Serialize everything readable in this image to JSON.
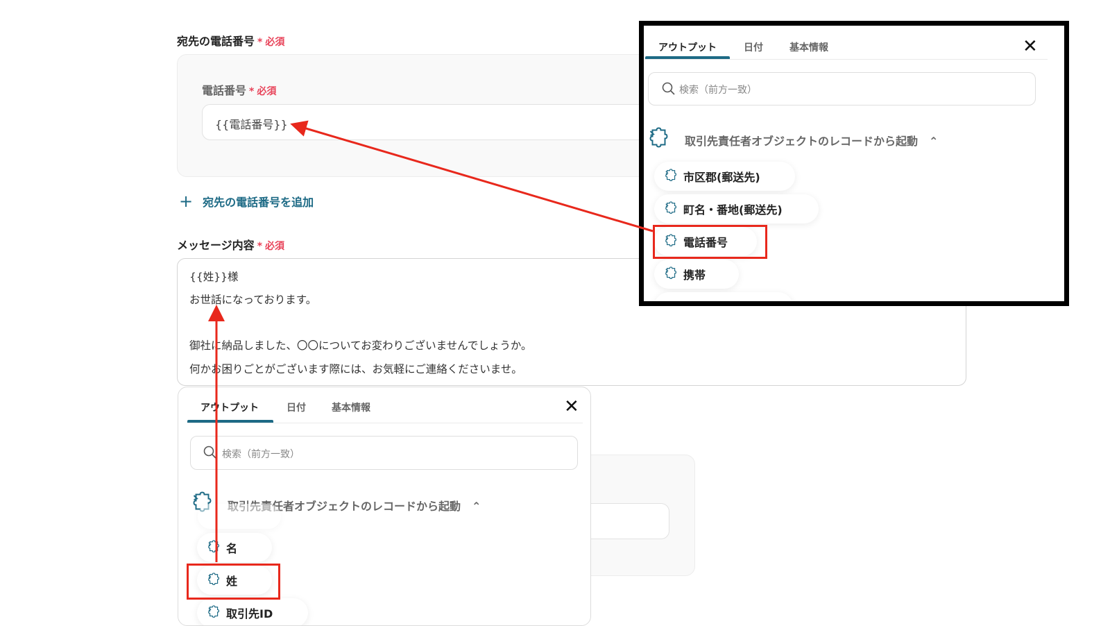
{
  "form": {
    "phone_section": {
      "label": "宛先の電話番号",
      "required": "必須",
      "required_mark": "*"
    },
    "phone_field": {
      "label": "電話番号",
      "required": "必須",
      "required_mark": "*",
      "value": "{{電話番号}}"
    },
    "add_phone_label": "宛先の電話番号を追加",
    "message_section": {
      "label": "メッセージ内容",
      "required": "必須",
      "required_mark": "*"
    },
    "message_lines": [
      "{{姓}}様",
      "お世話になっております。",
      "",
      "御社に納品しました、〇〇についてお変わりございませんでしょうか。",
      "何かお困りごとがございます際には、お気軽にご連絡くださいませ。"
    ]
  },
  "popup_top": {
    "tabs": [
      "アウトプット",
      "日付",
      "基本情報"
    ],
    "search_placeholder": "検索（前方一致）",
    "group_title": "取引先責任者オブジェクトのレコードから起動",
    "items": [
      "市区郡(郵送先)",
      "町名・番地(郵送先)",
      "電話番号",
      "携帯"
    ],
    "highlighted": "電話番号"
  },
  "popup_bottom": {
    "tabs": [
      "アウトプット",
      "日付",
      "基本情報"
    ],
    "search_placeholder": "検索（前方一致）",
    "group_title": "取引先責任者オブジェクトのレコードから起動",
    "items": [
      "名",
      "姓",
      "取引先ID"
    ],
    "highlighted": "姓"
  },
  "colors": {
    "accent": "#1d6a85",
    "required": "#e8445a",
    "annotation": "#e8281c"
  }
}
